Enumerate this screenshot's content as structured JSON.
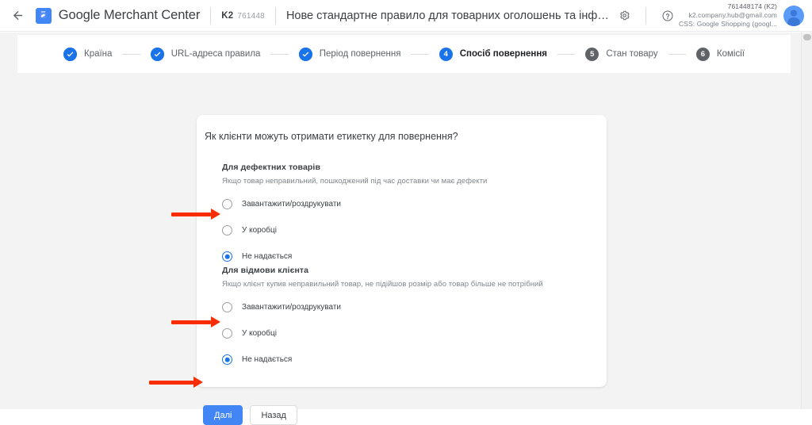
{
  "header": {
    "back_icon": "arrow-left-icon",
    "logo_icon": "merchant-center-logo-icon",
    "brand_bold": "Google",
    "brand_light": " Merchant Center",
    "account_chip": {
      "code": "K2",
      "number": "761448"
    },
    "doc_title": "Нове стандартне правило для товарних оголошень та інформації ...",
    "settings_icon": "gear-icon",
    "help_icon": "help-circle-icon",
    "account": {
      "line1": "761448174 (K2)",
      "line2": "k2.company.hub@gmail.com",
      "line3": "CSS: Google Shopping (googl..."
    },
    "avatar_icon": "user-avatar-icon",
    "colors": {
      "brand_blue": "#4285f4",
      "avatar_blue": "#5b9bf8"
    }
  },
  "stepper": {
    "steps": [
      {
        "index": "1",
        "label": "Країна",
        "state": "done",
        "glyph": "check-icon"
      },
      {
        "index": "2",
        "label": "URL-адреса правила",
        "state": "done",
        "glyph": "check-icon"
      },
      {
        "index": "3",
        "label": "Період повернення",
        "state": "done",
        "glyph": "check-icon"
      },
      {
        "index": "4",
        "label": "Спосіб повернення",
        "state": "active",
        "glyph": "4"
      },
      {
        "index": "5",
        "label": "Стан товару",
        "state": "todo",
        "glyph": "5"
      },
      {
        "index": "6",
        "label": "Комісії",
        "state": "todo",
        "glyph": "6"
      }
    ],
    "colors": {
      "active": "#1a73e8",
      "todo": "#5f6368",
      "connector": "#dadce0"
    }
  },
  "main": {
    "question": "Як клієнти можуть отримати етикетку для повернення?",
    "groups": [
      {
        "title": "Для дефектних товарів",
        "description": "Якщо товар неправильний, пошкоджений під час доставки чи має дефекти",
        "options": [
          {
            "label": "Завантажити/роздрукувати",
            "selected": false
          },
          {
            "label": "У коробці",
            "selected": false
          },
          {
            "label": "Не надається",
            "selected": true
          }
        ]
      },
      {
        "title": "Для відмови клієнта",
        "description": "Якщо клієнт купив неправильний товар, не підійшов розмір або товар більше не потрібний",
        "options": [
          {
            "label": "Завантажити/роздрукувати",
            "selected": false
          },
          {
            "label": "У коробці",
            "selected": false
          },
          {
            "label": "Не надається",
            "selected": true
          }
        ]
      }
    ]
  },
  "footer": {
    "next_label": "Далі",
    "back_label": "Назад",
    "primary_color": "#4285f4"
  },
  "annotations": {
    "arrow_color": "#f92d00",
    "arrows": [
      {
        "name": "arrow-pointing-to-defective-not-provided"
      },
      {
        "name": "arrow-pointing-to-buyer-remorse-not-provided"
      },
      {
        "name": "arrow-pointing-to-next-button"
      }
    ]
  }
}
